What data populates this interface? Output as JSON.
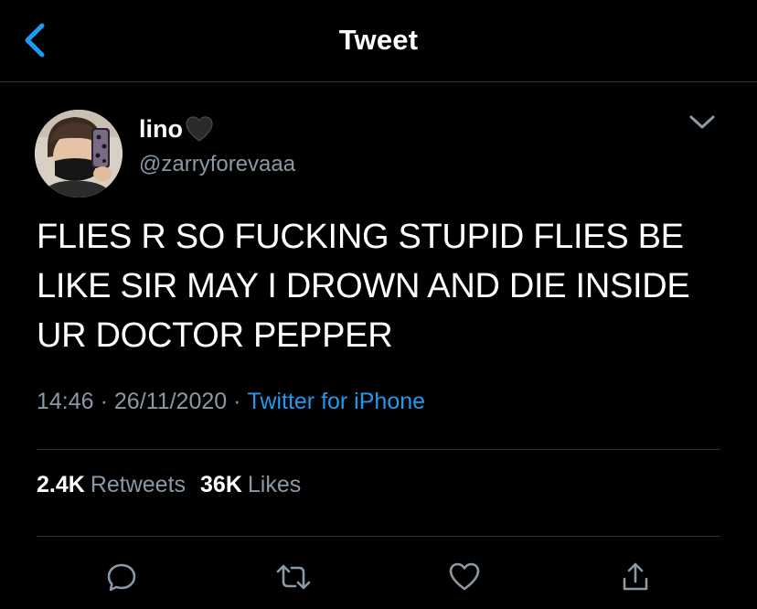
{
  "header": {
    "title": "Tweet",
    "back_icon": "chevron-left-icon"
  },
  "tweet": {
    "author": {
      "display_name": "lino",
      "name_emoji": "black-heart",
      "handle": "@zarryforevaaa",
      "avatar": "profile-photo"
    },
    "text": "FLIES R SO FUCKING STUPID FLIES BE LIKE SIR MAY I DROWN AND DIE INSIDE UR DOCTOR PEPPER",
    "time": "14:46",
    "date": "26/11/2020",
    "separator": "·",
    "source": "Twitter for iPhone"
  },
  "stats": {
    "retweets_count": "2.4K",
    "retweets_label": "Retweets",
    "likes_count": "36K",
    "likes_label": "Likes"
  },
  "actions": [
    {
      "name": "reply",
      "icon": "comment-icon"
    },
    {
      "name": "retweet",
      "icon": "retweet-icon"
    },
    {
      "name": "like",
      "icon": "heart-icon"
    },
    {
      "name": "share",
      "icon": "share-icon"
    }
  ],
  "colors": {
    "background": "#000000",
    "text": "#ffffff",
    "secondary": "#8b98a5",
    "accent": "#1d9bf0",
    "divider": "#2f3336"
  }
}
